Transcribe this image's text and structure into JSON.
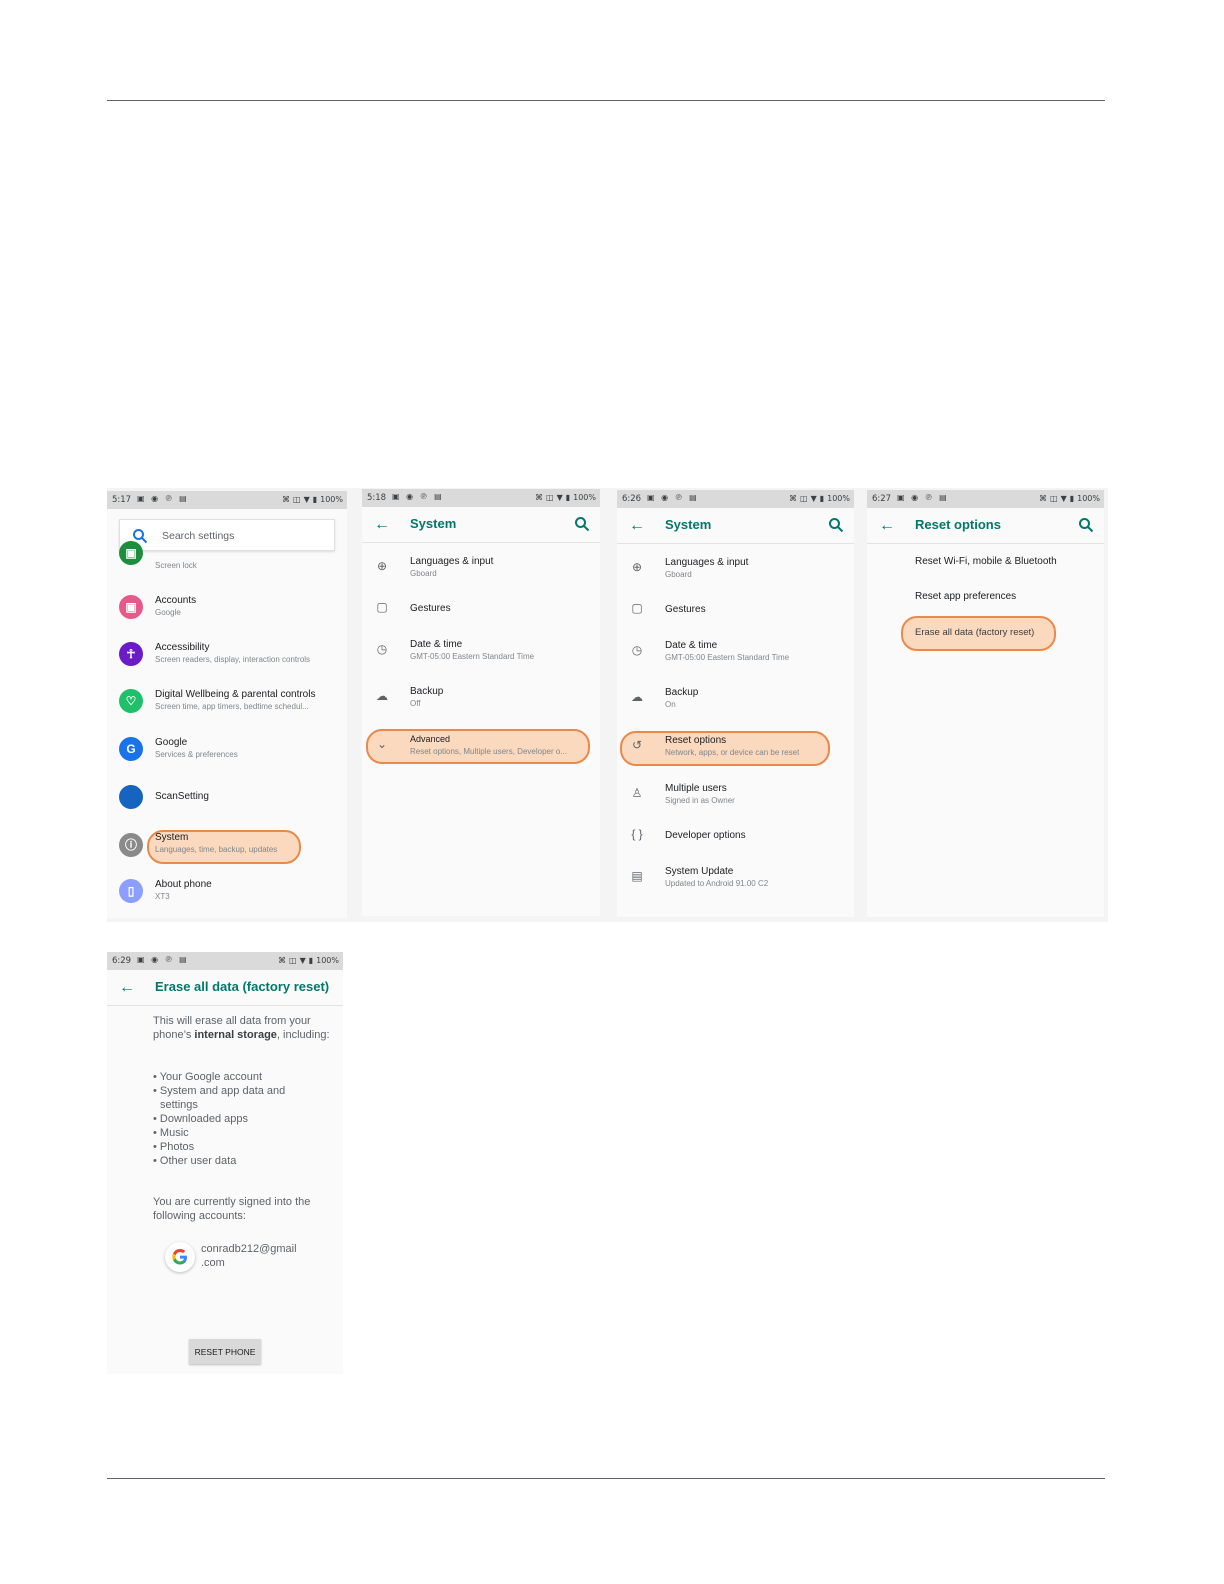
{
  "colors": {
    "accent": "#00796b",
    "highlight_border": "#e9894a",
    "highlight_fill": "#fbc8a0"
  },
  "screens": [
    {
      "status": {
        "time": "5:17",
        "battery": "100%"
      },
      "search_placeholder": "Search settings",
      "items": [
        {
          "title": "",
          "sub": "Screen lock",
          "icon": "lock-icon",
          "color": "#1e8e3e"
        },
        {
          "title": "Accounts",
          "sub": "Google",
          "icon": "account-icon",
          "color": "#e8588a"
        },
        {
          "title": "Accessibility",
          "sub": "Screen readers, display, interaction controls",
          "icon": "accessibility-icon",
          "color": "#6b1cc7"
        },
        {
          "title": "Digital Wellbeing & parental controls",
          "sub": "Screen time, app timers, bedtime schedul...",
          "icon": "wellbeing-icon",
          "color": "#1fc06a"
        },
        {
          "title": "Google",
          "sub": "Services & preferences",
          "icon": "google-icon",
          "color": "#1a73e8"
        },
        {
          "title": "ScanSetting",
          "sub": "",
          "icon": "scan-icon",
          "color": "#1565c0"
        },
        {
          "title": "System",
          "sub": "Languages, time, backup, updates",
          "icon": "info-icon",
          "color": "#8a8a8a"
        },
        {
          "title": "About phone",
          "sub": "XT3",
          "icon": "phone-icon",
          "color": "#8c9eff"
        }
      ]
    },
    {
      "status": {
        "time": "5:18",
        "battery": "100%"
      },
      "title": "System",
      "items": [
        {
          "title": "Languages & input",
          "sub": "Gboard",
          "icon": "globe-icon"
        },
        {
          "title": "Gestures",
          "sub": "",
          "icon": "gestures-icon"
        },
        {
          "title": "Date & time",
          "sub": "GMT-05:00 Eastern Standard Time",
          "icon": "clock-icon"
        },
        {
          "title": "Backup",
          "sub": "Off",
          "icon": "backup-icon"
        },
        {
          "title": "Advanced",
          "sub": "Reset options, Multiple users, Developer o...",
          "icon": "chevron-down-icon"
        }
      ]
    },
    {
      "status": {
        "time": "6:26",
        "battery": "100%"
      },
      "title": "System",
      "items": [
        {
          "title": "Languages & input",
          "sub": "Gboard",
          "icon": "globe-icon"
        },
        {
          "title": "Gestures",
          "sub": "",
          "icon": "gestures-icon"
        },
        {
          "title": "Date & time",
          "sub": "GMT-05:00 Eastern Standard Time",
          "icon": "clock-icon"
        },
        {
          "title": "Backup",
          "sub": "On",
          "icon": "backup-icon"
        },
        {
          "title": "Reset options",
          "sub": "Network, apps, or device can be reset",
          "icon": "history-icon"
        },
        {
          "title": "Multiple users",
          "sub": "Signed in as Owner",
          "icon": "person-icon"
        },
        {
          "title": "Developer options",
          "sub": "",
          "icon": "braces-icon"
        },
        {
          "title": "System Update",
          "sub": "Updated to Android 91.00 C2",
          "icon": "system-update-icon"
        }
      ]
    },
    {
      "status": {
        "time": "6:27",
        "battery": "100%"
      },
      "title": "Reset options",
      "items": [
        "Reset Wi-Fi, mobile & Bluetooth",
        "Reset app preferences",
        "Erase all data (factory reset)"
      ]
    },
    {
      "status": {
        "time": "6:29",
        "battery": "100%"
      },
      "title": "Erase all data (factory reset)",
      "intro_pre": "This will erase all data from your phone’s ",
      "intro_bold": "internal storage",
      "intro_post": ", including:",
      "bullets": [
        "• Your Google account",
        "• System and app data and settings",
        "• Downloaded apps",
        "• Music",
        "• Photos",
        "• Other user data"
      ],
      "signed_in_text": "You are currently signed into the following accounts:",
      "account_line1": "conradb212@gmail",
      "account_line2": ".com",
      "reset_button": "RESET PHONE"
    }
  ]
}
